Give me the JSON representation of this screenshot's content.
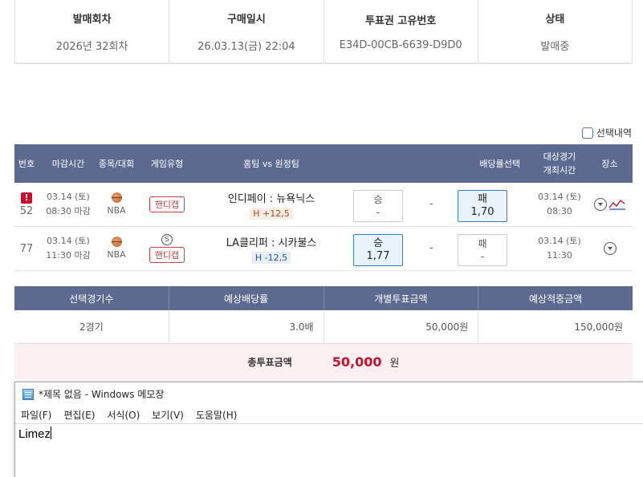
{
  "info": {
    "cols": [
      {
        "label": "발매회차",
        "value": "2026년 32회차"
      },
      {
        "label": "구매일시",
        "value": "26.03.13(금) 22:04"
      },
      {
        "label": "투표권 고유번호",
        "value": "E34D-00CB-6639-D9D0"
      },
      {
        "label": "상태",
        "value": "발매중"
      }
    ]
  },
  "select_history_label": "선택내역",
  "games": {
    "headers": {
      "no": "번호",
      "deadline": "마감시간",
      "sport": "종목/대회",
      "type": "게임유형",
      "teams": "홈팀 vs 원정팀",
      "odds": "배당률선택",
      "sched_1": "대상경기",
      "sched_2": "개최시간",
      "venue": "장소"
    },
    "rows": [
      {
        "warn": "!",
        "no": "52",
        "date": "03.14 (토)",
        "deadline": "08:30 마감",
        "league": "NBA",
        "type": "핸디캡",
        "teams": "인디페이 : 뉴욕닉스",
        "handicap": "H +12,5",
        "left_label": "승",
        "left_value": "-",
        "mid": "-",
        "right_label": "패",
        "right_value": "1,70",
        "sched_date": "03.14 (토)",
        "sched_time": "08:30"
      },
      {
        "no": "77",
        "date": "03.14 (토)",
        "deadline": "11:30 마감",
        "league": "NBA",
        "type_icon": "S",
        "type": "핸디캡",
        "teams": "LA클리퍼 : 시카불스",
        "handicap": "H -12,5",
        "left_label": "승",
        "left_value": "1,77",
        "mid": "-",
        "right_label": "패",
        "right_value": "-",
        "sched_date": "03.14 (토)",
        "sched_time": "11:30"
      }
    ]
  },
  "summary": {
    "headers": [
      "선택경기수",
      "예상배당률",
      "개별투표금액",
      "예상적중금액"
    ],
    "values": [
      "2경기",
      "3.0배",
      "50,000원",
      "150,000원"
    ],
    "total_label": "총투표금액",
    "total_amount": "50,000",
    "total_unit": "원"
  },
  "notepad": {
    "title": "*제목 없음 - Windows 메모장",
    "menu": [
      "파일(F)",
      "편집(E)",
      "서식(O)",
      "보기(V)",
      "도움말(H)"
    ],
    "content": "Limez"
  },
  "colors": {
    "header_bg": "#5b6a8e",
    "accent_red": "#c8102e",
    "selected_odd_bg": "#e8f3fb"
  }
}
